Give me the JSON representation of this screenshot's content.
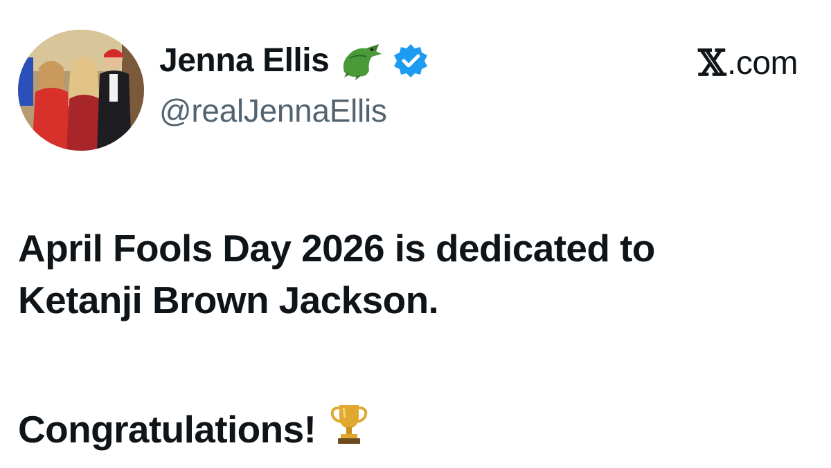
{
  "author": {
    "display_name": "Jenna Ellis",
    "handle": "@realJennaEllis",
    "name_emoji": "alligator-icon",
    "verified_badge": "verified-badge-icon",
    "badge_color": "#1d9bf0"
  },
  "site": {
    "label": ".com",
    "logo": "x-logo-icon"
  },
  "tweet": {
    "line1": "April Fools Day 2026 is dedicated to",
    "line2": "Ketanji Brown Jackson.",
    "congrats": "Congratulations!",
    "trophy": "trophy-icon"
  },
  "colors": {
    "text": "#0f1419",
    "secondary_text": "#536471"
  }
}
